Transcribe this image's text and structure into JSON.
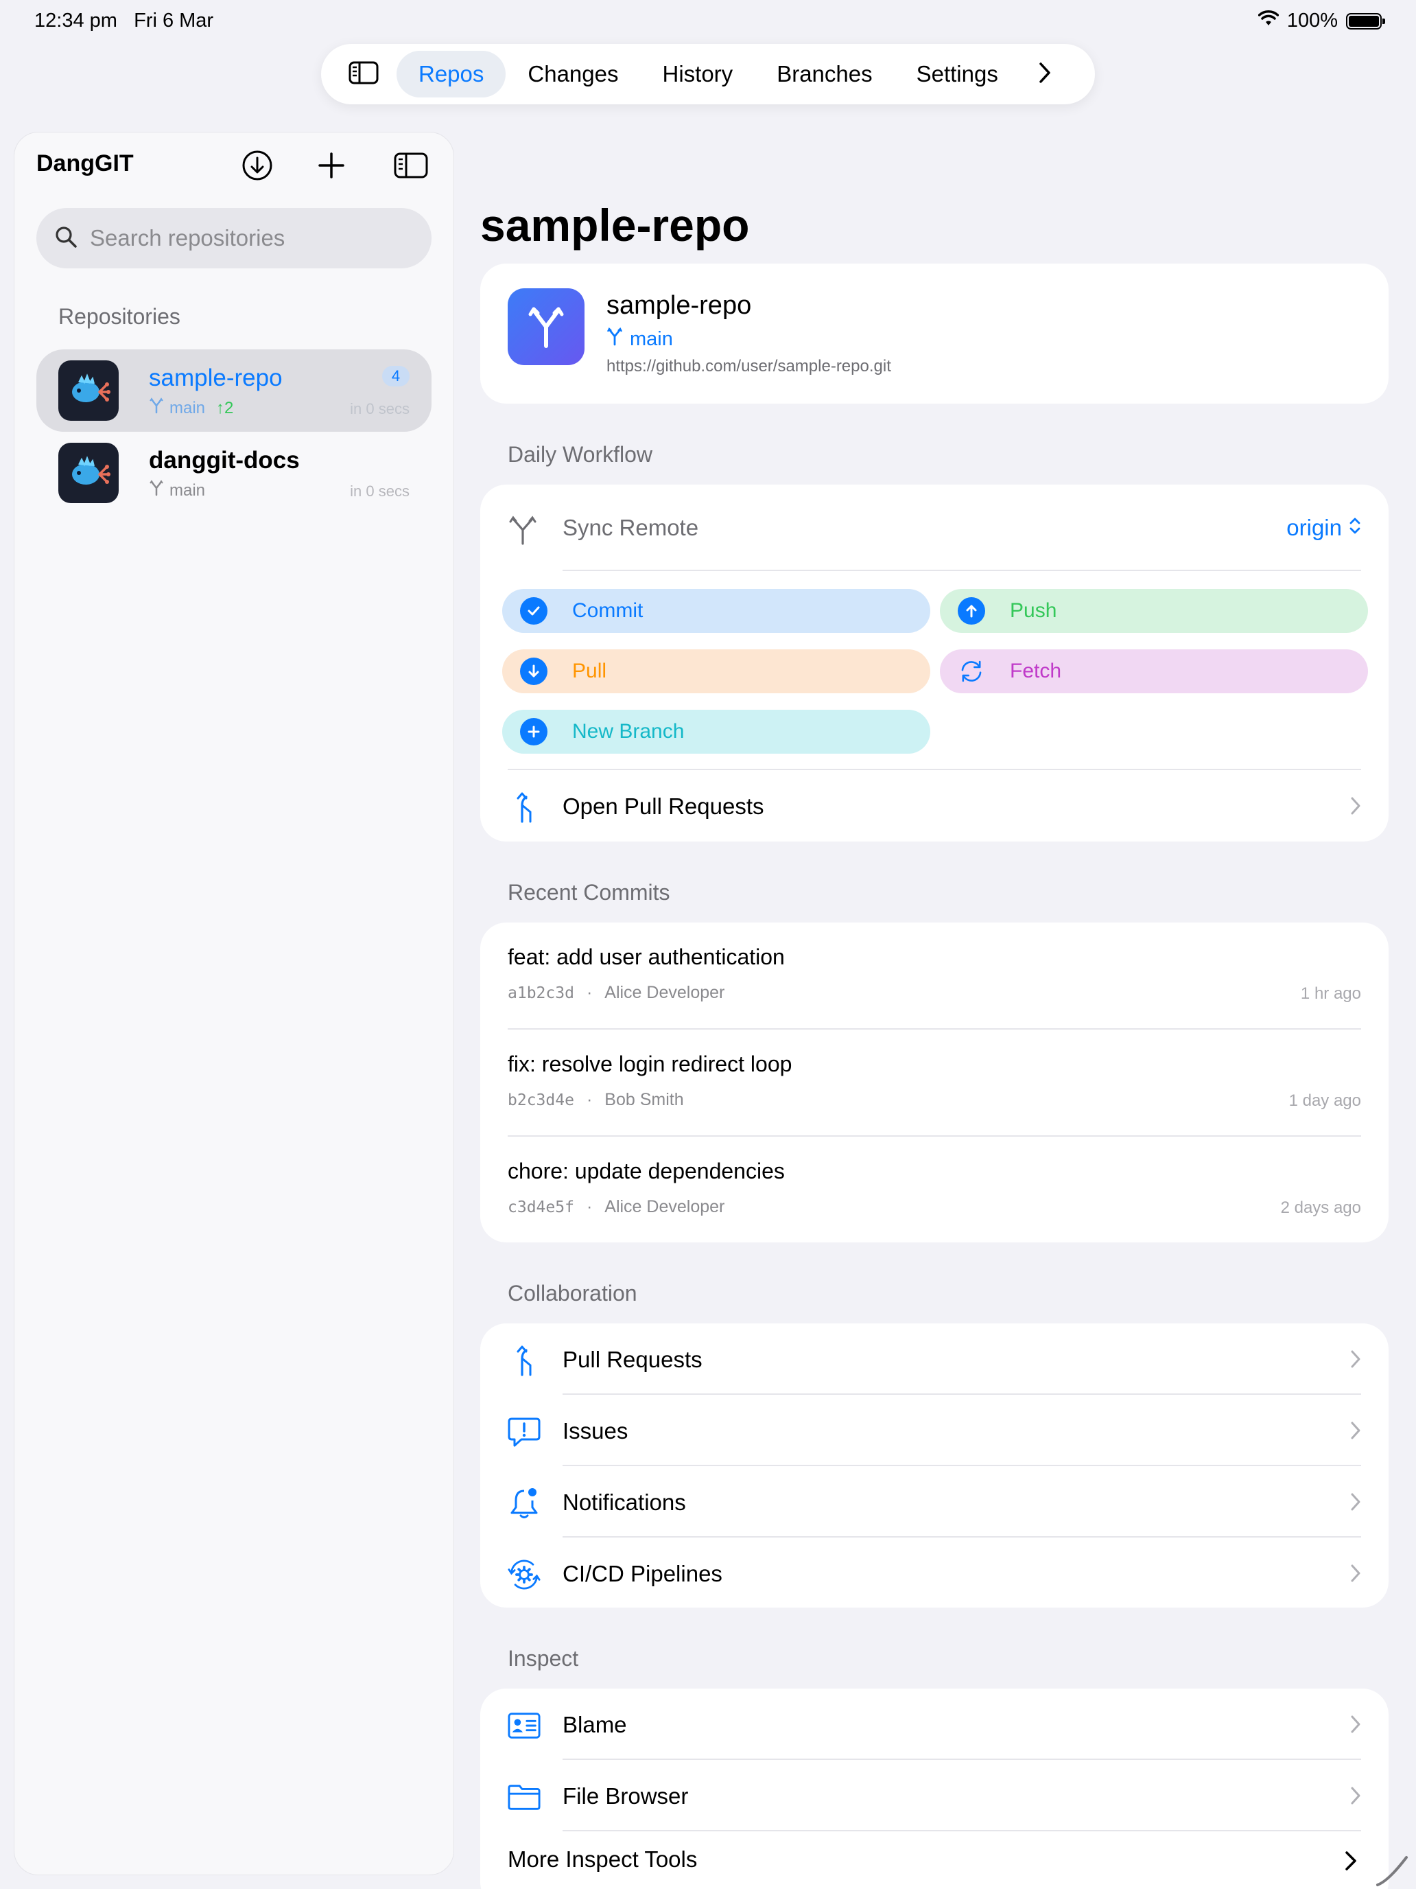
{
  "status_bar": {
    "time": "12:34 pm",
    "date": "Fri 6 Mar",
    "battery": "100%",
    "battery_level": 1.0
  },
  "tab_bar": {
    "sidebar_toggle_icon": "sidebar-icon",
    "tabs": [
      {
        "label": "Repos",
        "active": true
      },
      {
        "label": "Changes",
        "active": false
      },
      {
        "label": "History",
        "active": false
      },
      {
        "label": "Branches",
        "active": false
      },
      {
        "label": "Settings",
        "active": false
      }
    ],
    "more_icon": "chevron-right-icon"
  },
  "sidebar": {
    "app_title": "DangGIT",
    "search_placeholder": "Search repositories",
    "section_title": "Repositories",
    "repos": [
      {
        "name": "sample-repo",
        "branch": "main",
        "ahead": "2",
        "badge": "4",
        "time": "in 0 secs",
        "selected": true
      },
      {
        "name": "danggit-docs",
        "branch": "main",
        "time": "in 0 secs",
        "selected": false
      }
    ]
  },
  "main": {
    "title": "sample-repo",
    "repo_card": {
      "name": "sample-repo",
      "branch": "main",
      "url": "https://github.com/user/sample-repo.git"
    },
    "daily_workflow": {
      "header": "Daily Workflow",
      "sync_label": "Sync Remote",
      "remote": "origin",
      "actions": {
        "commit": "Commit",
        "push": "Push",
        "pull": "Pull",
        "fetch": "Fetch",
        "new_branch": "New Branch"
      },
      "open_prs": "Open Pull Requests"
    },
    "recent_commits": {
      "header": "Recent Commits",
      "items": [
        {
          "message": "feat: add user authentication",
          "sha": "a1b2c3d",
          "author": "Alice Developer",
          "time": "1 hr ago"
        },
        {
          "message": "fix: resolve login redirect loop",
          "sha": "b2c3d4e",
          "author": "Bob Smith",
          "time": "1 day ago"
        },
        {
          "message": "chore: update dependencies",
          "sha": "c3d4e5f",
          "author": "Alice Developer",
          "time": "2 days ago"
        }
      ]
    },
    "collaboration": {
      "header": "Collaboration",
      "items": [
        "Pull Requests",
        "Issues",
        "Notifications",
        "CI/CD Pipelines"
      ]
    },
    "inspect": {
      "header": "Inspect",
      "items": [
        "Blame",
        "File Browser"
      ],
      "more": "More Inspect Tools"
    }
  },
  "colors": {
    "accent": "#0a7aff",
    "background": "#f2f2f7",
    "green": "#34c759",
    "orange": "#ff9500",
    "purple": "#c03ac9",
    "teal": "#14b8c8"
  }
}
